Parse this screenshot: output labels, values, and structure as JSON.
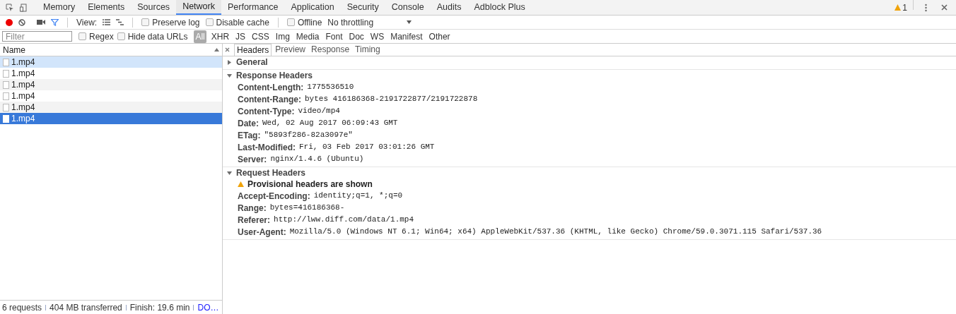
{
  "panel_tabs": [
    {
      "label": "Memory",
      "selected": false
    },
    {
      "label": "Elements",
      "selected": false
    },
    {
      "label": "Sources",
      "selected": false
    },
    {
      "label": "Network",
      "selected": true
    },
    {
      "label": "Performance",
      "selected": false
    },
    {
      "label": "Application",
      "selected": false
    },
    {
      "label": "Security",
      "selected": false
    },
    {
      "label": "Console",
      "selected": false
    },
    {
      "label": "Audits",
      "selected": false
    },
    {
      "label": "Adblock Plus",
      "selected": false
    }
  ],
  "warning_count": "1",
  "toolbar": {
    "recording": true,
    "view_label": "View:",
    "checkboxes": [
      {
        "label": "Preserve log",
        "checked": false
      },
      {
        "label": "Disable cache",
        "checked": false
      },
      {
        "label": "Offline",
        "checked": false
      }
    ],
    "throttling": "No throttling"
  },
  "filter": {
    "placeholder": "Filter",
    "checkboxes": [
      {
        "label": "Regex",
        "checked": false
      },
      {
        "label": "Hide data URLs",
        "checked": false
      }
    ],
    "types": [
      {
        "label": "All",
        "selected": true
      },
      {
        "label": "XHR",
        "selected": false
      },
      {
        "label": "JS",
        "selected": false
      },
      {
        "label": "CSS",
        "selected": false
      },
      {
        "label": "Img",
        "selected": false
      },
      {
        "label": "Media",
        "selected": false
      },
      {
        "label": "Font",
        "selected": false
      },
      {
        "label": "Doc",
        "selected": false
      },
      {
        "label": "WS",
        "selected": false
      },
      {
        "label": "Manifest",
        "selected": false
      },
      {
        "label": "Other",
        "selected": false
      }
    ]
  },
  "requests": {
    "column": "Name",
    "rows": [
      {
        "name": "1.mp4",
        "selected": false,
        "hovered": true
      },
      {
        "name": "1.mp4",
        "selected": false,
        "hovered": false
      },
      {
        "name": "1.mp4",
        "selected": false,
        "hovered": false
      },
      {
        "name": "1.mp4",
        "selected": false,
        "hovered": false
      },
      {
        "name": "1.mp4",
        "selected": false,
        "hovered": false
      },
      {
        "name": "1.mp4",
        "selected": true,
        "hovered": false
      }
    ]
  },
  "detail": {
    "tabs": [
      {
        "label": "Headers",
        "selected": true
      },
      {
        "label": "Preview",
        "selected": false
      },
      {
        "label": "Response",
        "selected": false
      },
      {
        "label": "Timing",
        "selected": false
      }
    ],
    "sections": [
      {
        "title": "General",
        "expanded": false
      },
      {
        "title": "Response Headers",
        "expanded": true,
        "headers": [
          {
            "name": "Content-Length:",
            "value": "1775536510"
          },
          {
            "name": "Content-Range:",
            "value": "bytes 416186368-2191722877/2191722878"
          },
          {
            "name": "Content-Type:",
            "value": "video/mp4"
          },
          {
            "name": "Date:",
            "value": "Wed, 02 Aug 2017 06:09:43 GMT"
          },
          {
            "name": "ETag:",
            "value": "\"5893f286-82a3097e\""
          },
          {
            "name": "Last-Modified:",
            "value": "Fri, 03 Feb 2017 03:01:26 GMT"
          },
          {
            "name": "Server:",
            "value": "nginx/1.4.6 (Ubuntu)"
          }
        ]
      },
      {
        "title": "Request Headers",
        "expanded": true,
        "warning": "Provisional headers are shown",
        "headers": [
          {
            "name": "Accept-Encoding:",
            "value": "identity;q=1, *;q=0"
          },
          {
            "name": "Range:",
            "value": "bytes=416186368-"
          },
          {
            "name": "Referer:",
            "value": "http://lww.diff.com/data/1.mp4"
          },
          {
            "name": "User-Agent:",
            "value": "Mozilla/5.0 (Windows NT 6.1; Win64; x64) AppleWebKit/537.36 (KHTML, like Gecko) Chrome/59.0.3071.115 Safari/537.36"
          }
        ]
      }
    ]
  },
  "status_bar": [
    {
      "text": "6 requests",
      "kind": "plain"
    },
    {
      "text": "404 MB transferred",
      "kind": "plain"
    },
    {
      "text": "Finish: 19.6 min",
      "kind": "plain"
    },
    {
      "text": "DO…",
      "kind": "link"
    }
  ]
}
